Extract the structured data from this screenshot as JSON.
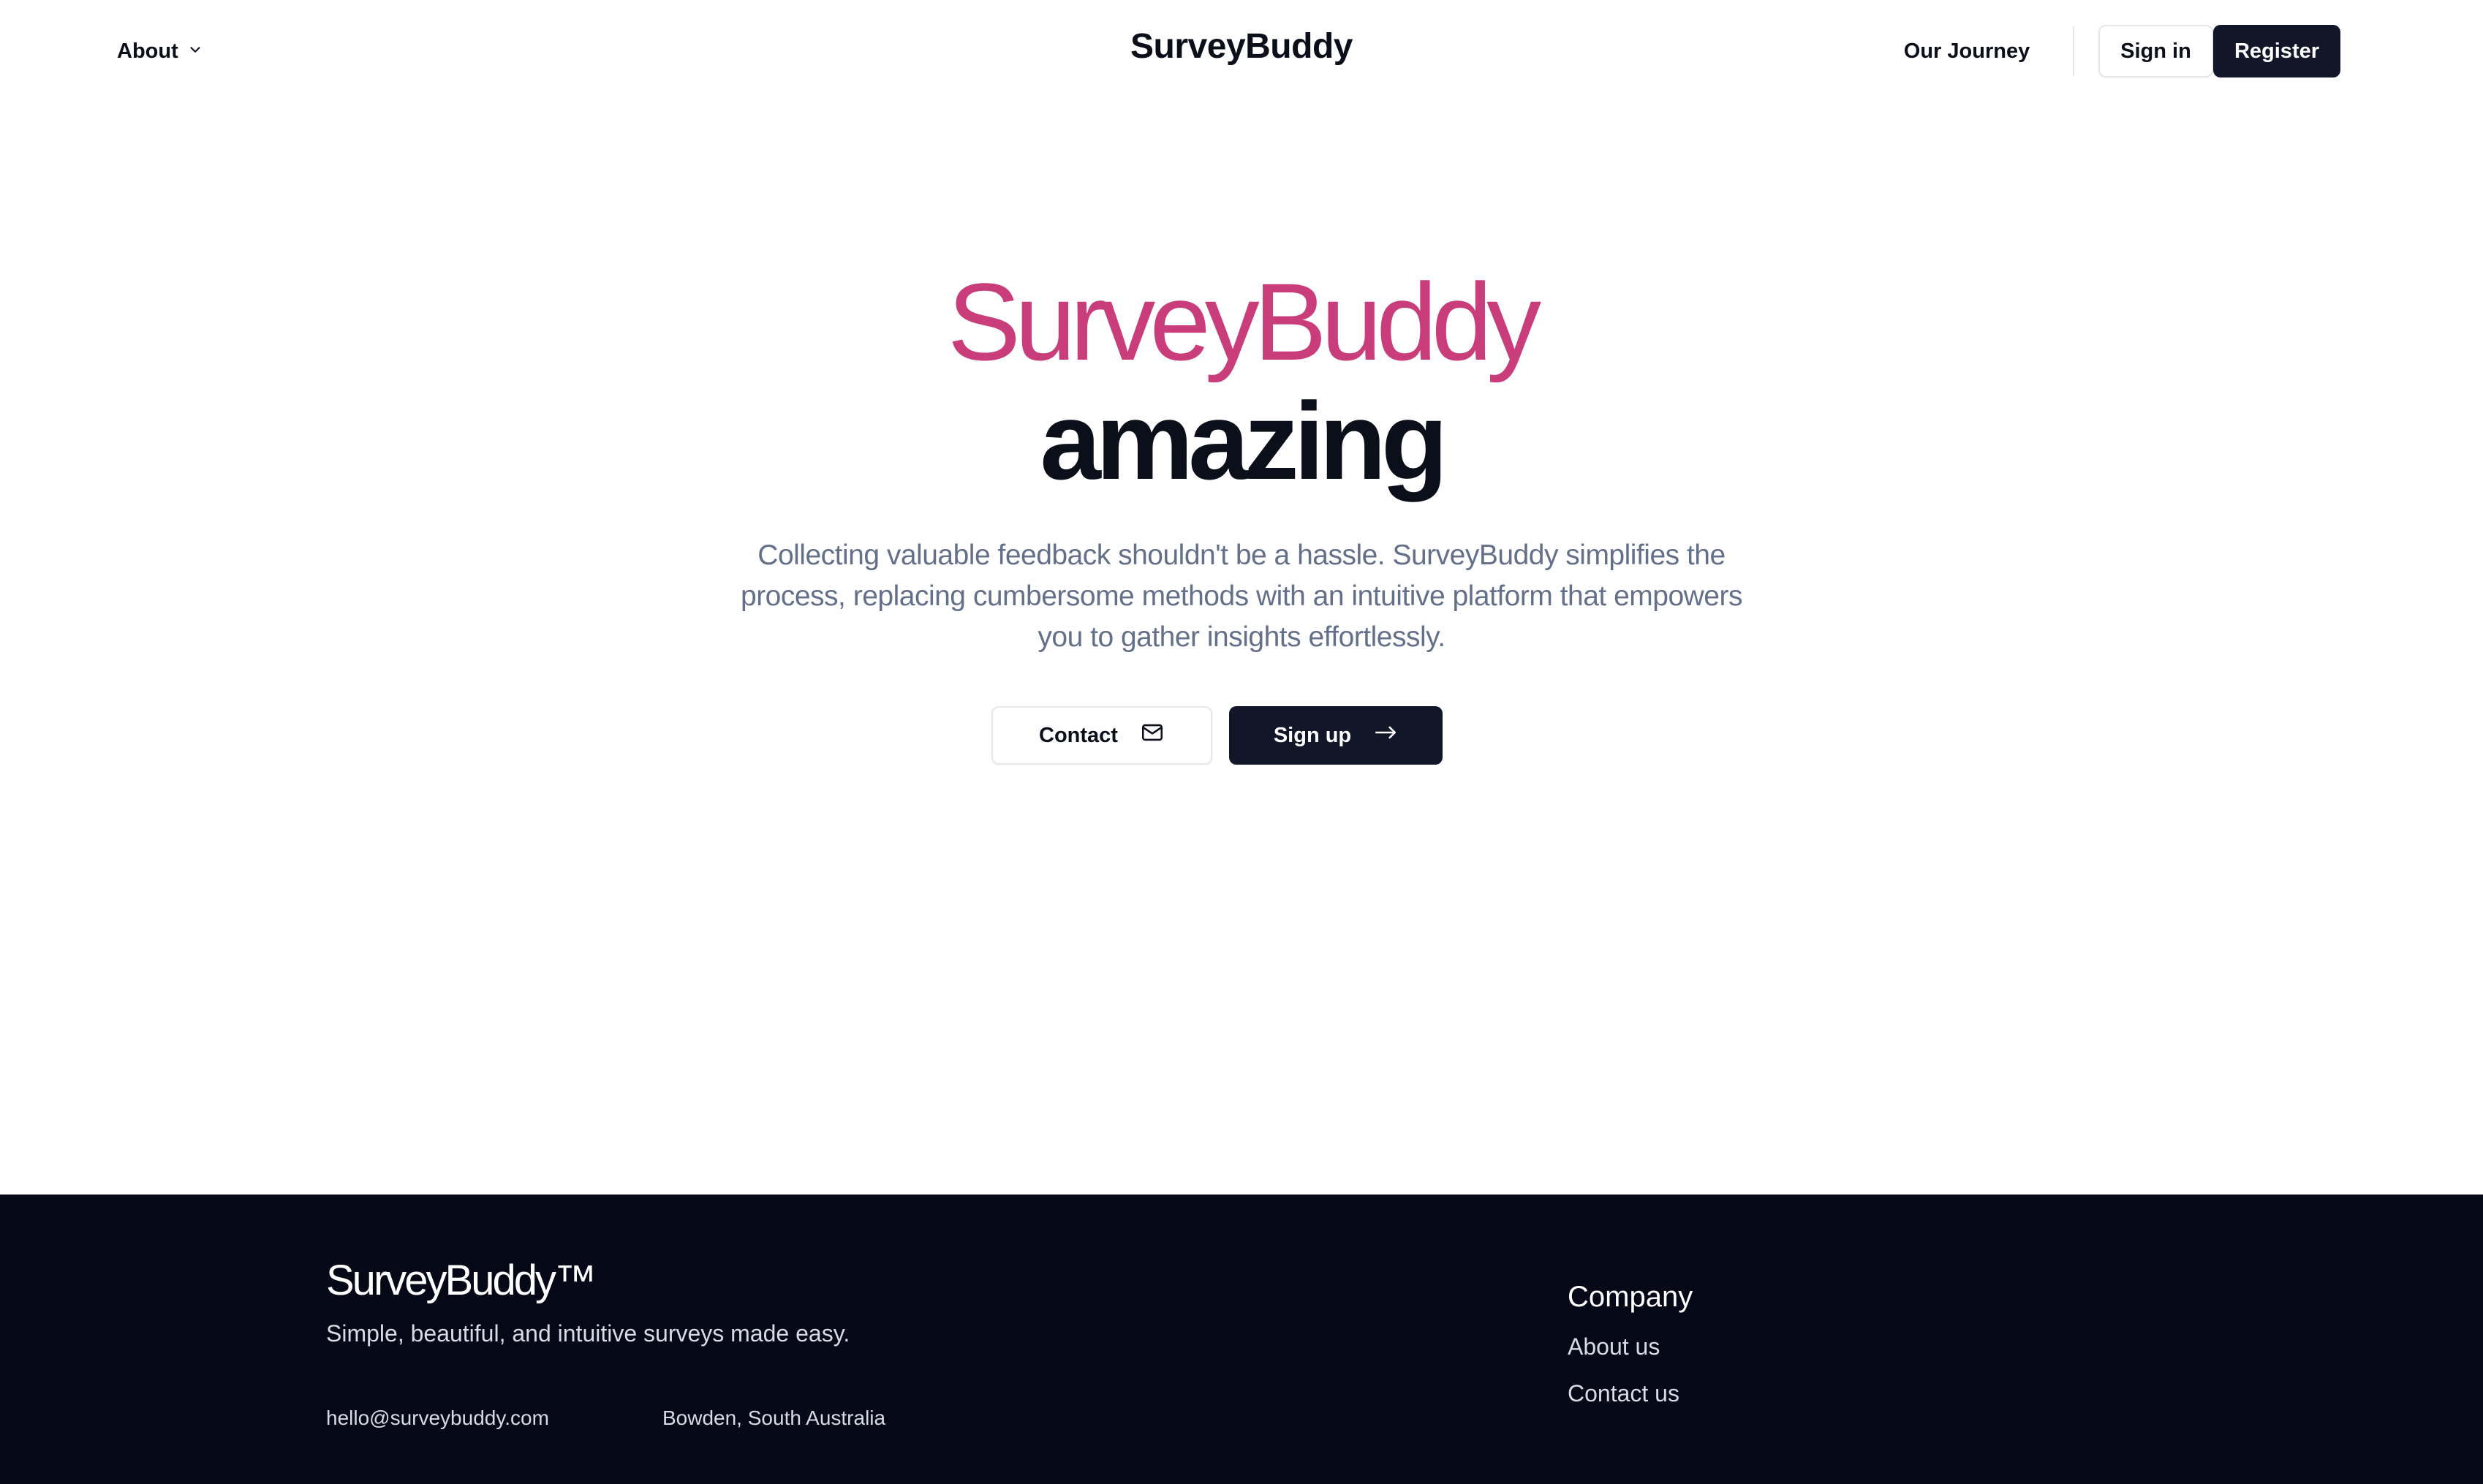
{
  "header": {
    "about_label": "About",
    "brand": "SurveyBuddy",
    "journey_label": "Our Journey",
    "signin_label": "Sign in",
    "register_label": "Register"
  },
  "hero": {
    "title_line1": "SurveyBuddy",
    "title_line2": "amazing",
    "description": "Collecting valuable feedback shouldn't be a hassle. SurveyBuddy simplifies the process, replacing cumbersome methods with an intuitive platform that empowers you to gather insights effortlessly.",
    "contact_label": "Contact",
    "signup_label": "Sign up"
  },
  "footer": {
    "brand": "SurveyBuddy™",
    "tagline": "Simple, beautiful, and intuitive surveys made easy.",
    "email": "hello@surveybuddy.com",
    "location": "Bowden, South Australia",
    "company_heading": "Company",
    "links": [
      "About us",
      "Contact us"
    ]
  },
  "colors": {
    "accent_pink": "#c93d7a",
    "dark_button": "#111628",
    "footer_bg": "#050816",
    "body_text_muted": "#64708a"
  },
  "icons": {
    "about_chevron": "chevron-down-icon",
    "contact": "mail-icon",
    "signup": "arrow-right-icon"
  }
}
